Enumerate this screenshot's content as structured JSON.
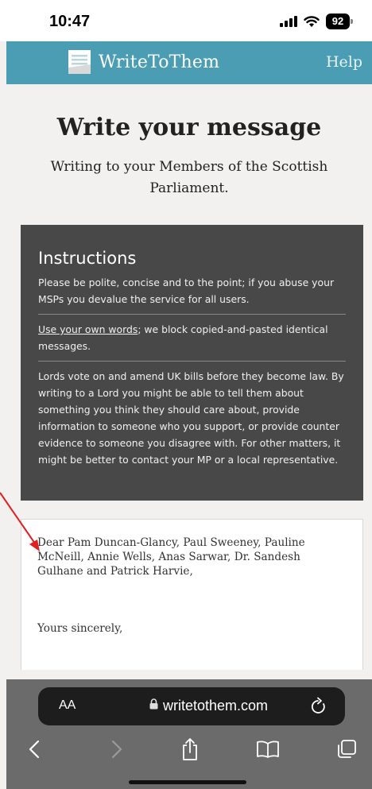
{
  "status_bar": {
    "time": "10:47",
    "battery": "92"
  },
  "header": {
    "app_name": "WriteToThem",
    "help_label": "Help",
    "brand_color": "#4a9db3"
  },
  "page": {
    "title": "Write your message",
    "subtitle": "Writing to your Members of the Scottish Parliament."
  },
  "instructions": {
    "heading": "Instructions",
    "paragraph1": "Please be polite, concise and to the point; if you abuse your MSPs you devalue the service for all users.",
    "own_words_link": "Use your own words",
    "paragraph2_rest": "; we block copied-and-pasted identical messages.",
    "paragraph3": "Lords vote on and amend UK bills before they become law. By writing to a Lord you might be able to tell them about something you think they should care about, provide information to someone who you support, or provide counter evidence to someone you disagree with. For other matters, it might be better to contact your MP or a local representative.",
    "background_color": "#484848"
  },
  "message": {
    "salutation": "Dear Pam Duncan-Glancy, Paul Sweeney, Pauline McNeill, Annie Wells, Anas Sarwar, Dr. Sandesh Gulhane and Patrick Harvie,",
    "signoff": "Yours sincerely,"
  },
  "browser": {
    "text_size_label": "AA",
    "url": "writetothem.com",
    "icons": [
      "lock-icon",
      "reload-icon",
      "back-icon",
      "forward-icon",
      "share-icon",
      "bookmarks-icon",
      "tabs-icon"
    ]
  },
  "annotation": {
    "arrow_color": "#e02020"
  }
}
